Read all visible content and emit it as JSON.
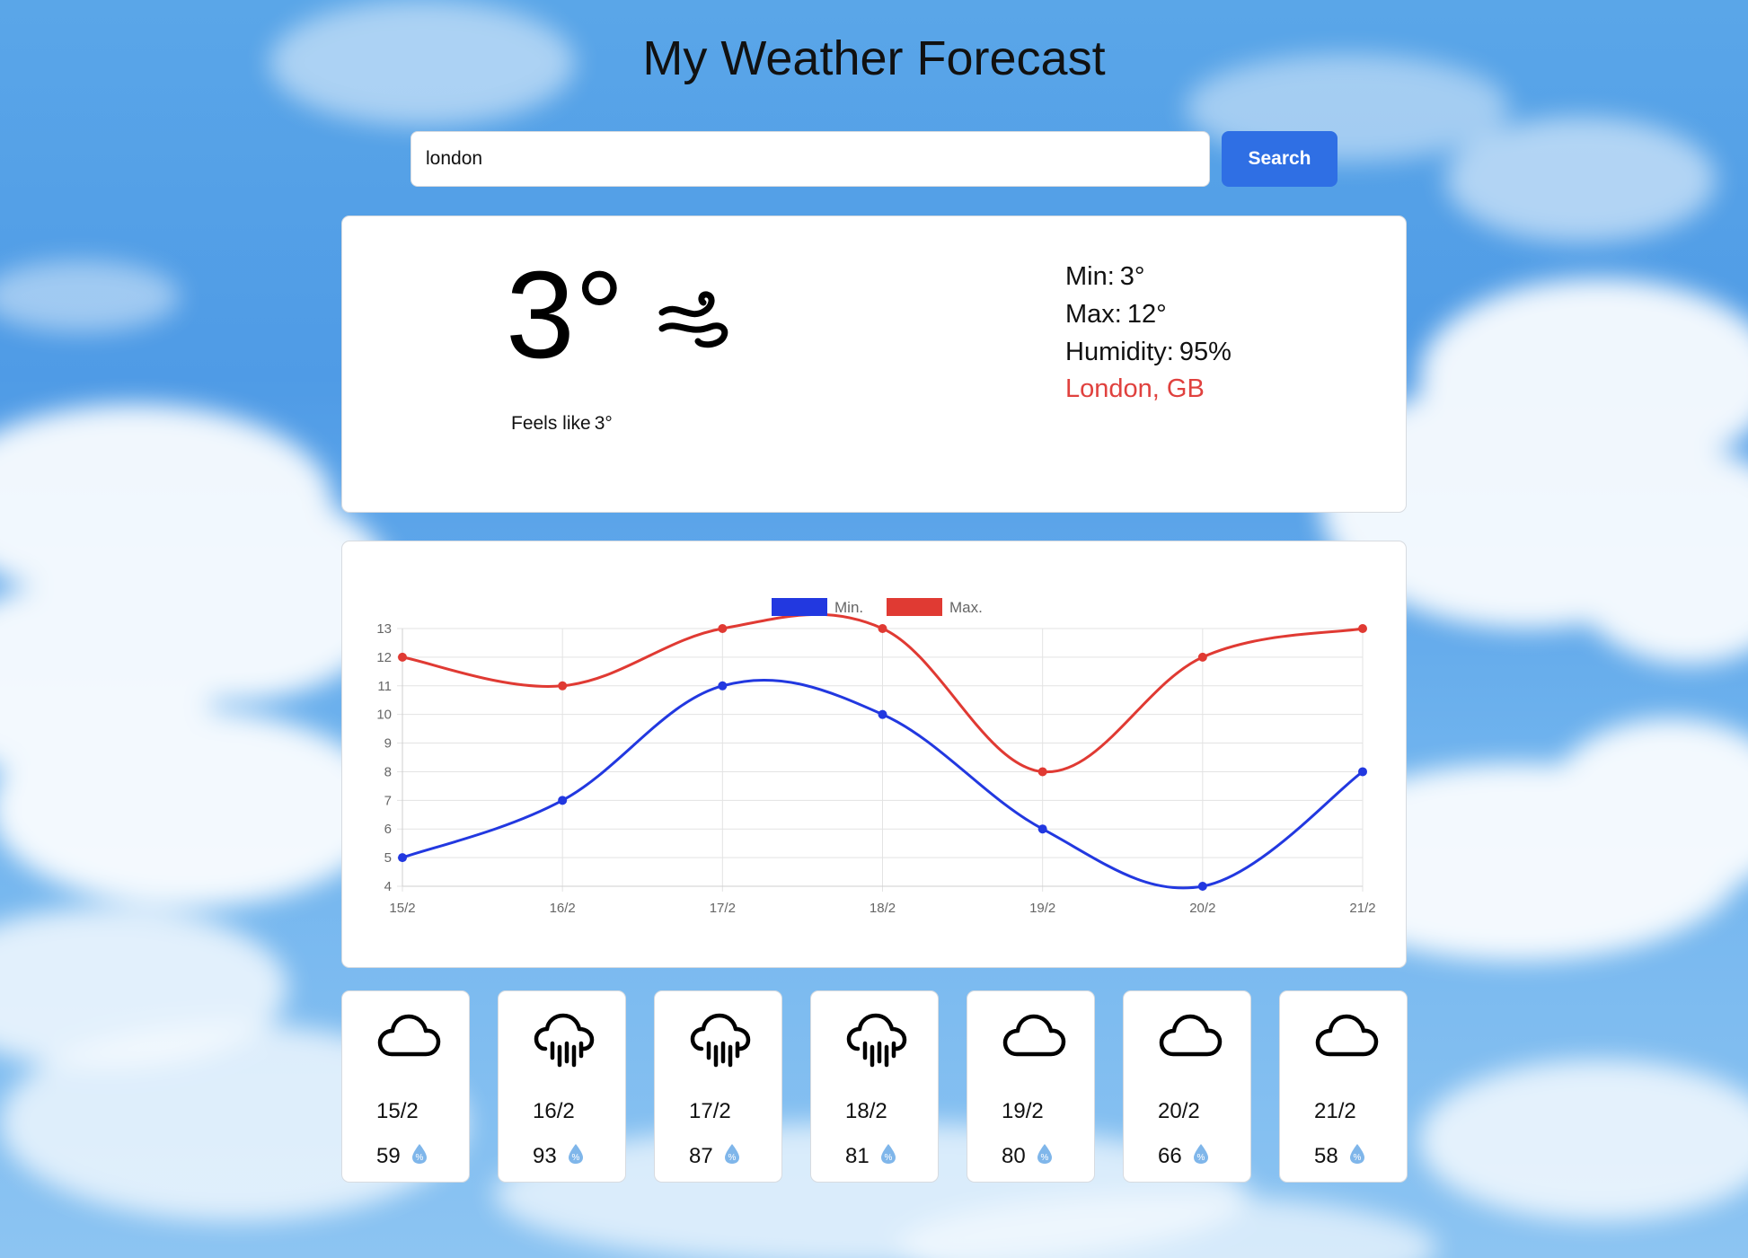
{
  "header": {
    "title": "My Weather Forecast"
  },
  "search": {
    "value": "london",
    "button_label": "Search"
  },
  "current": {
    "temperature": "3°",
    "feels_like_label": "Feels like",
    "feels_like_value": "3°",
    "min_label": "Min:",
    "min_value": "3°",
    "max_label": "Max:",
    "max_value": "12°",
    "humidity_label": "Humidity:",
    "humidity_value": "95%",
    "location": "London, GB",
    "condition_icon": "wind-icon"
  },
  "chart_data": {
    "type": "line",
    "x": [
      "15/2",
      "16/2",
      "17/2",
      "18/2",
      "19/2",
      "20/2",
      "21/2"
    ],
    "series": [
      {
        "name": "Min.",
        "color": "#2238e0",
        "values": [
          5,
          7,
          11,
          10,
          6,
          4,
          8
        ]
      },
      {
        "name": "Max.",
        "color": "#e03a33",
        "values": [
          12,
          11,
          13,
          13,
          8,
          12,
          13
        ]
      }
    ],
    "ylim": [
      4,
      13
    ],
    "yticks": [
      4,
      5,
      6,
      7,
      8,
      9,
      10,
      11,
      12,
      13
    ],
    "grid": true,
    "legend": "top-center"
  },
  "forecast": [
    {
      "date": "15/2",
      "humidity": "59",
      "icon": "cloud-icon"
    },
    {
      "date": "16/2",
      "humidity": "93",
      "icon": "rain-cloud-icon"
    },
    {
      "date": "17/2",
      "humidity": "87",
      "icon": "rain-cloud-icon"
    },
    {
      "date": "18/2",
      "humidity": "81",
      "icon": "rain-cloud-icon"
    },
    {
      "date": "19/2",
      "humidity": "80",
      "icon": "cloud-icon"
    },
    {
      "date": "20/2",
      "humidity": "66",
      "icon": "cloud-icon"
    },
    {
      "date": "21/2",
      "humidity": "58",
      "icon": "cloud-icon"
    }
  ],
  "colors": {
    "accent": "#2f6fe4",
    "location": "#e0413e",
    "drop": "#7fb6ea"
  }
}
